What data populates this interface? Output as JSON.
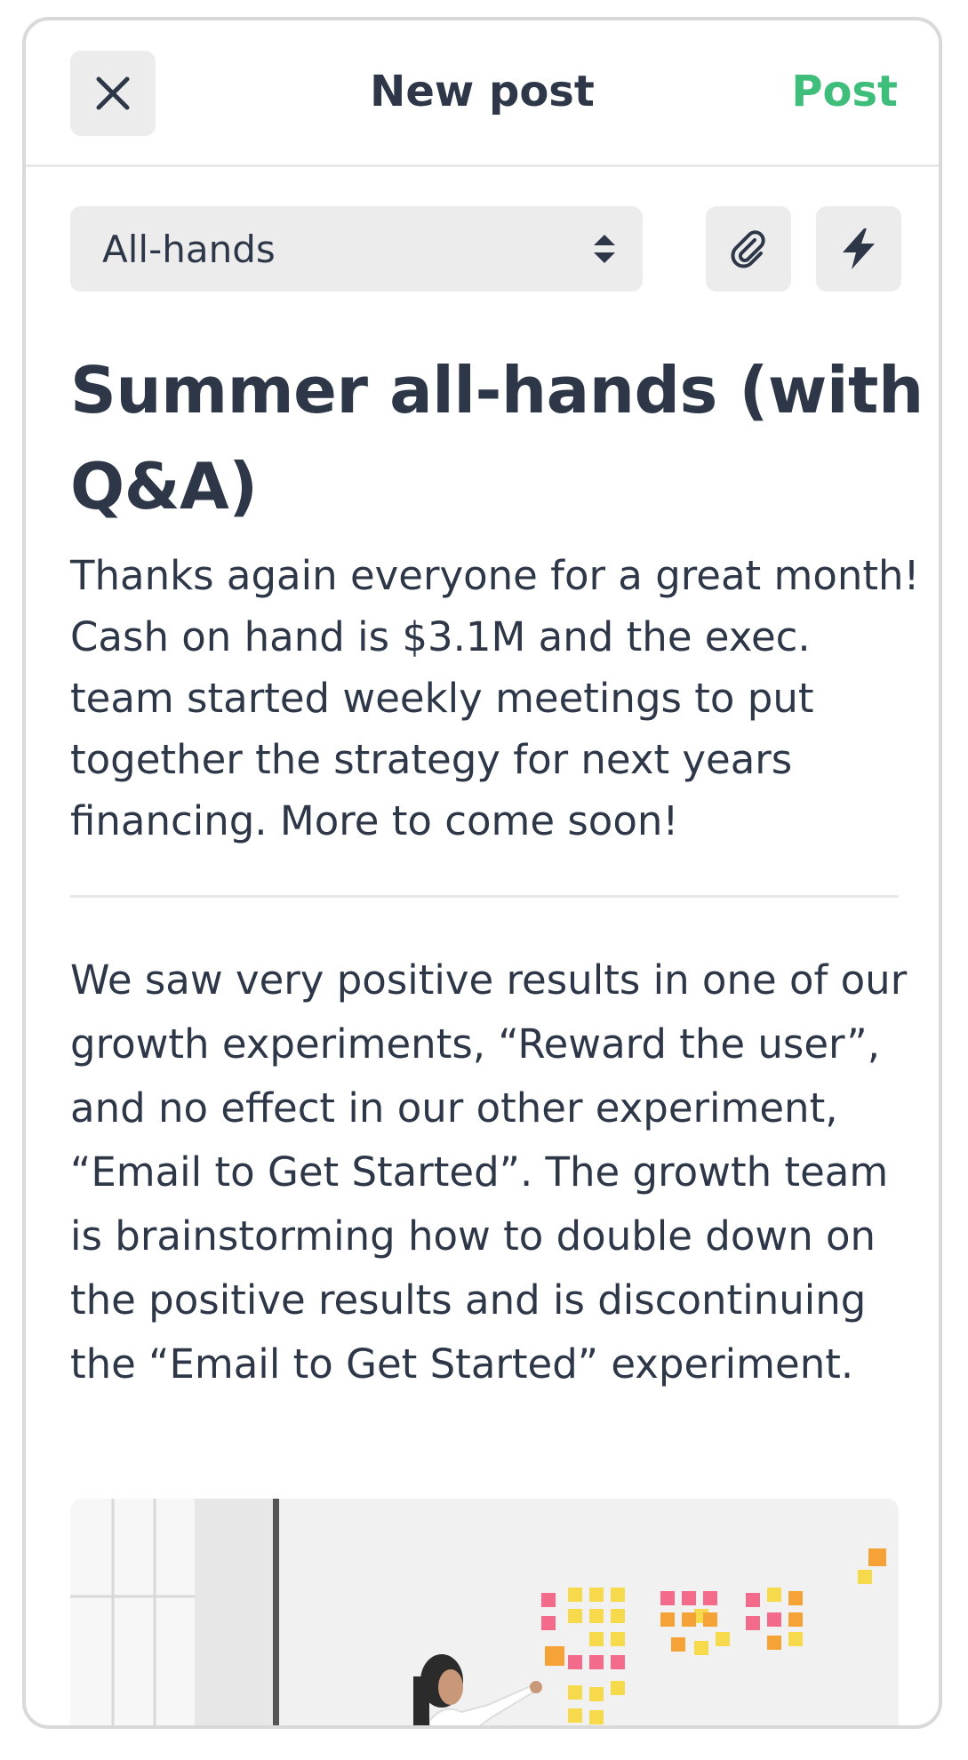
{
  "header": {
    "title": "New post",
    "post_label": "Post"
  },
  "toolbar": {
    "channel": "All-hands"
  },
  "post": {
    "title": "Summer all-hands (with Q&A)",
    "paragraph1": "Thanks again everyone for a great month! Cash on hand is $3.1M and the exec. team started weekly meetings to put together the strategy for next years financing. More to come soon!",
    "paragraph2": "We saw very positive results in one of our growth experiments, “Reward the user”, and no effect in our other experiment, “Email to Get Started”. The growth team is brainstorming how to double down on the positive results and is discontinuing the “Email to Get Started” experiment."
  },
  "colors": {
    "accent": "#3ebd7b",
    "text": "#2d3748",
    "button_bg": "#ececec"
  },
  "icons": {
    "close": "close-icon",
    "select": "chevron-updown-icon",
    "attach": "paperclip-icon",
    "flash": "lightning-icon"
  }
}
